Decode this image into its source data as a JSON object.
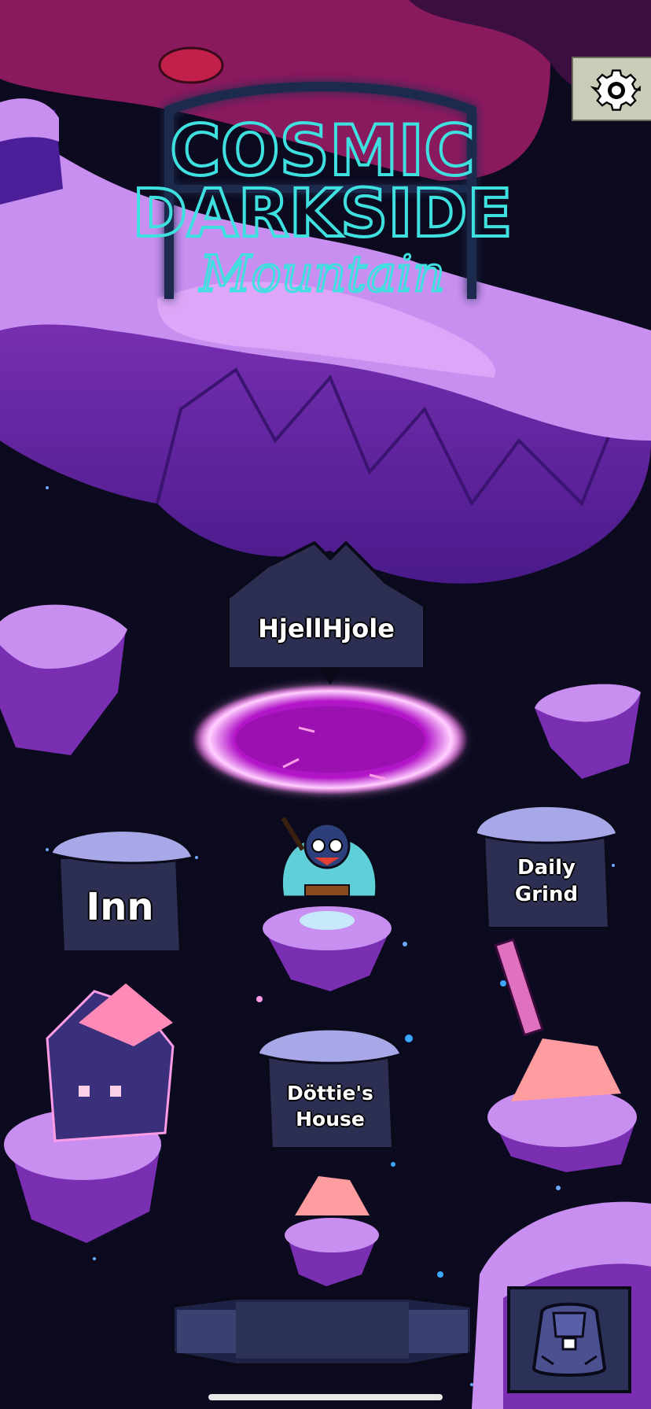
{
  "title": {
    "line1": "COSMIC",
    "line2": "DARKSIDE",
    "line3": "Mountain"
  },
  "locations": {
    "portal_sign": "HjellHjole",
    "inn_sign": "Inn",
    "daily_grind_line1": "Daily",
    "daily_grind_line2": "Grind",
    "dotties_line1": "Döttie's",
    "dotties_line2": "House"
  },
  "icons": {
    "settings": "gear-icon",
    "inventory": "backpack-icon"
  },
  "colors": {
    "sky": "#0b0a1e",
    "rock_purple": "#7a2fb3",
    "snow": "#c98ff0",
    "neon_cyan": "#3fe0e0",
    "portal_magenta": "#ff4df0",
    "sign_panel": "#2c2f52"
  }
}
